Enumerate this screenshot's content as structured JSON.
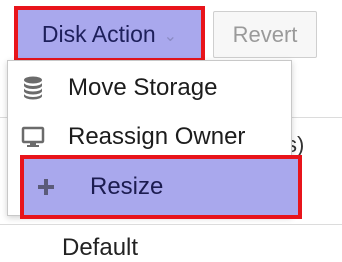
{
  "toolbar": {
    "disk_action_label": "Disk Action",
    "revert_label": "Revert"
  },
  "menu": {
    "items": [
      {
        "label": "Move Storage",
        "icon": "database-icon"
      },
      {
        "label": "Reassign Owner",
        "icon": "monitor-icon"
      },
      {
        "label": "Resize",
        "icon": "plus-icon"
      }
    ]
  },
  "background": {
    "bracket_fragment": "]",
    "paren_fragment": "s)",
    "row_text": "Default"
  },
  "colors": {
    "highlight_fill": "#a9a8ed",
    "highlight_border": "#e8141b"
  }
}
